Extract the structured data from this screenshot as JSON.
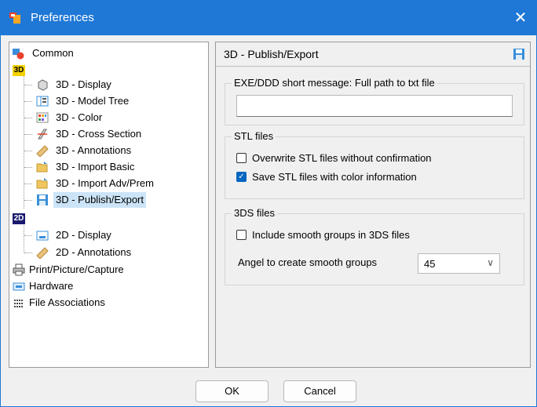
{
  "window": {
    "title": "Preferences",
    "close_glyph": "✕"
  },
  "tree": {
    "common": "Common",
    "group3d_badge": "3D",
    "items3d": [
      "3D - Display",
      "3D - Model Tree",
      "3D - Color",
      "3D - Cross Section",
      "3D - Annotations",
      "3D - Import Basic",
      "3D - Import Adv/Prem",
      "3D - Publish/Export"
    ],
    "group2d_badge": "2D",
    "items2d": [
      "2D - Display",
      "2D - Annotations"
    ],
    "print": "Print/Picture/Capture",
    "hardware": "Hardware",
    "file_assoc": "File Associations",
    "selected": "3D - Publish/Export"
  },
  "panel": {
    "title": "3D - Publish/Export",
    "exe_group": {
      "legend": "EXE/DDD short message: Full path to txt file",
      "value": ""
    },
    "stl_group": {
      "legend": "STL files",
      "overwrite_label": "Overwrite STL files without confirmation",
      "overwrite_checked": false,
      "color_label": "Save STL files with color information",
      "color_checked": true
    },
    "ds_group": {
      "legend": "3DS files",
      "smooth_label": "Include smooth groups in 3DS files",
      "smooth_checked": false,
      "angle_label": "Angel to create smooth groups",
      "angle_value": "45"
    }
  },
  "buttons": {
    "ok": "OK",
    "cancel": "Cancel"
  },
  "colors": {
    "titlebar": "#1f78d6",
    "selection": "#cce4f7",
    "check_on": "#0067c0"
  }
}
